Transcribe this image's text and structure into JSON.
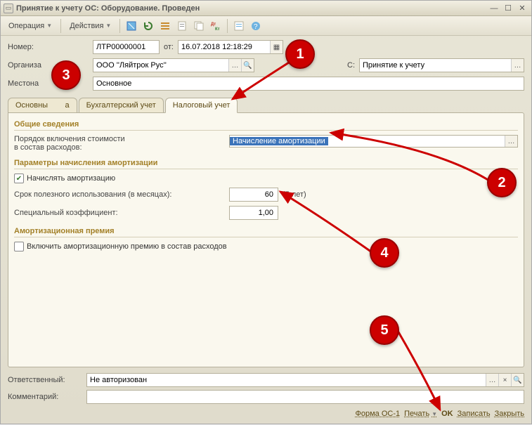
{
  "window": {
    "title": "Принятие к учету ОС: Оборудование. Проведен"
  },
  "toolbar": {
    "operation": "Операция",
    "actions": "Действия"
  },
  "form": {
    "number_label": "Номер:",
    "number_value": "ЛТР00000001",
    "ot_label": "от:",
    "date_value": "16.07.2018 12:18:29",
    "org_label": "Организа",
    "org_value": "ООО ''Ляйтрок Рус''",
    "os_label": "С:",
    "os_value": "Принятие к учету",
    "loc_label": "Местона",
    "loc_value": "Основное"
  },
  "tabs": {
    "t0": "Основны",
    "t0b": "а",
    "t1": "Бухгалтерский учет",
    "t2": "Налоговый учет"
  },
  "tax": {
    "section_general": "Общие сведения",
    "expense_label1": "Порядок включения стоимости",
    "expense_label2": "в состав расходов:",
    "expense_value": "Начисление амортизации",
    "section_amort": "Параметры начисления амортизации",
    "amort_check": "Начислять амортизацию",
    "useful_life_label": "Срок полезного использования (в месяцах):",
    "useful_life_value": "60",
    "useful_life_years": "(5 лет)",
    "coeff_label": "Специальный коэффициент:",
    "coeff_value": "1,00",
    "section_bonus": "Амортизационная премия",
    "bonus_check": "Включить амортизационную премию в состав расходов"
  },
  "footer": {
    "resp_label": "Ответственный:",
    "resp_value": "Не авторизован",
    "comment_label": "Комментарий:"
  },
  "buttons": {
    "form_os1": "Форма ОС-1",
    "print": "Печать",
    "ok": "OK",
    "save": "Записать",
    "close": "Закрыть"
  },
  "markers": {
    "m1": "1",
    "m2": "2",
    "m3": "3",
    "m4": "4",
    "m5": "5"
  }
}
